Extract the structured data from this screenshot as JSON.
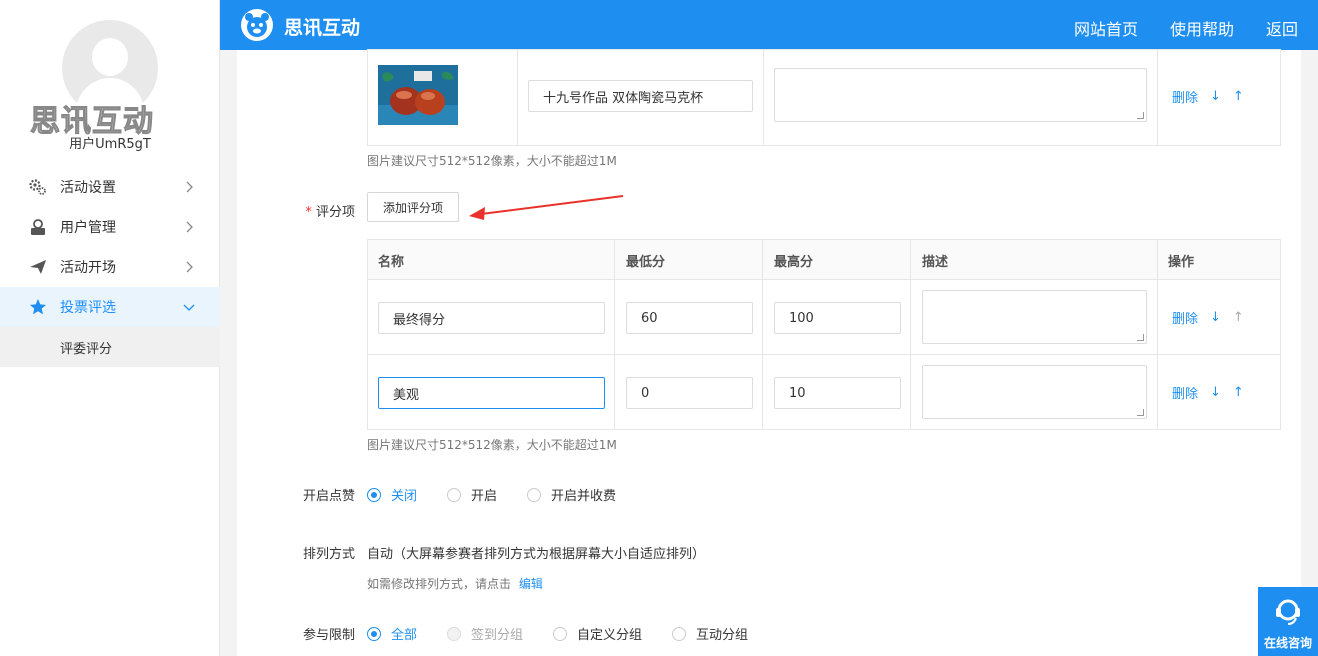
{
  "sidebar": {
    "watermark": "思讯互动",
    "username": "用户UmR5gT",
    "items": [
      {
        "label": "活动设置",
        "icon": "gears-icon"
      },
      {
        "label": "用户管理",
        "icon": "user-card-icon"
      },
      {
        "label": "活动开场",
        "icon": "paper-plane-icon"
      },
      {
        "label": "投票评选",
        "icon": "star-icon",
        "active": true
      }
    ],
    "submenu": [
      {
        "label": "评委评分"
      }
    ]
  },
  "header": {
    "brand": "思讯互动",
    "nav": [
      "网站首页",
      "使用帮助",
      "返回"
    ]
  },
  "works": {
    "row": {
      "title": "十九号作品  双体陶瓷马克杯",
      "ops": {
        "delete": "删除",
        "down": "↓",
        "up": "↑"
      }
    },
    "hint": "图片建议尺寸512*512像素，大小不能超过1M"
  },
  "scoring": {
    "label": "评分项",
    "required_mark": "*",
    "add_button": "添加评分项",
    "columns": [
      "名称",
      "最低分",
      "最高分",
      "描述",
      "操作"
    ],
    "rows": [
      {
        "name": "最终得分",
        "min": "60",
        "max": "100"
      },
      {
        "name": "美观",
        "min": "0",
        "max": "10"
      }
    ],
    "ops": {
      "delete": "删除",
      "down": "↓",
      "up": "↑"
    },
    "hint": "图片建议尺寸512*512像素，大小不能超过1M"
  },
  "likes": {
    "label": "开启点赞",
    "options": [
      "关闭",
      "开启",
      "开启并收费"
    ],
    "selected": "关闭"
  },
  "sort": {
    "label": "排列方式",
    "value": "自动（大屏幕参赛者排列方式为根据屏幕大小自适应排列）",
    "hint": "如需修改排列方式，请点击",
    "edit_link": "编辑"
  },
  "limit": {
    "label": "参与限制",
    "options": [
      "全部",
      "签到分组",
      "自定义分组",
      "互动分组"
    ],
    "selected": "全部",
    "disabled": [
      "签到分组"
    ]
  },
  "chat": {
    "label": "在线咨询"
  },
  "colors": {
    "primary": "#1e8ff0",
    "annotation_arrow": "#e8322b"
  }
}
